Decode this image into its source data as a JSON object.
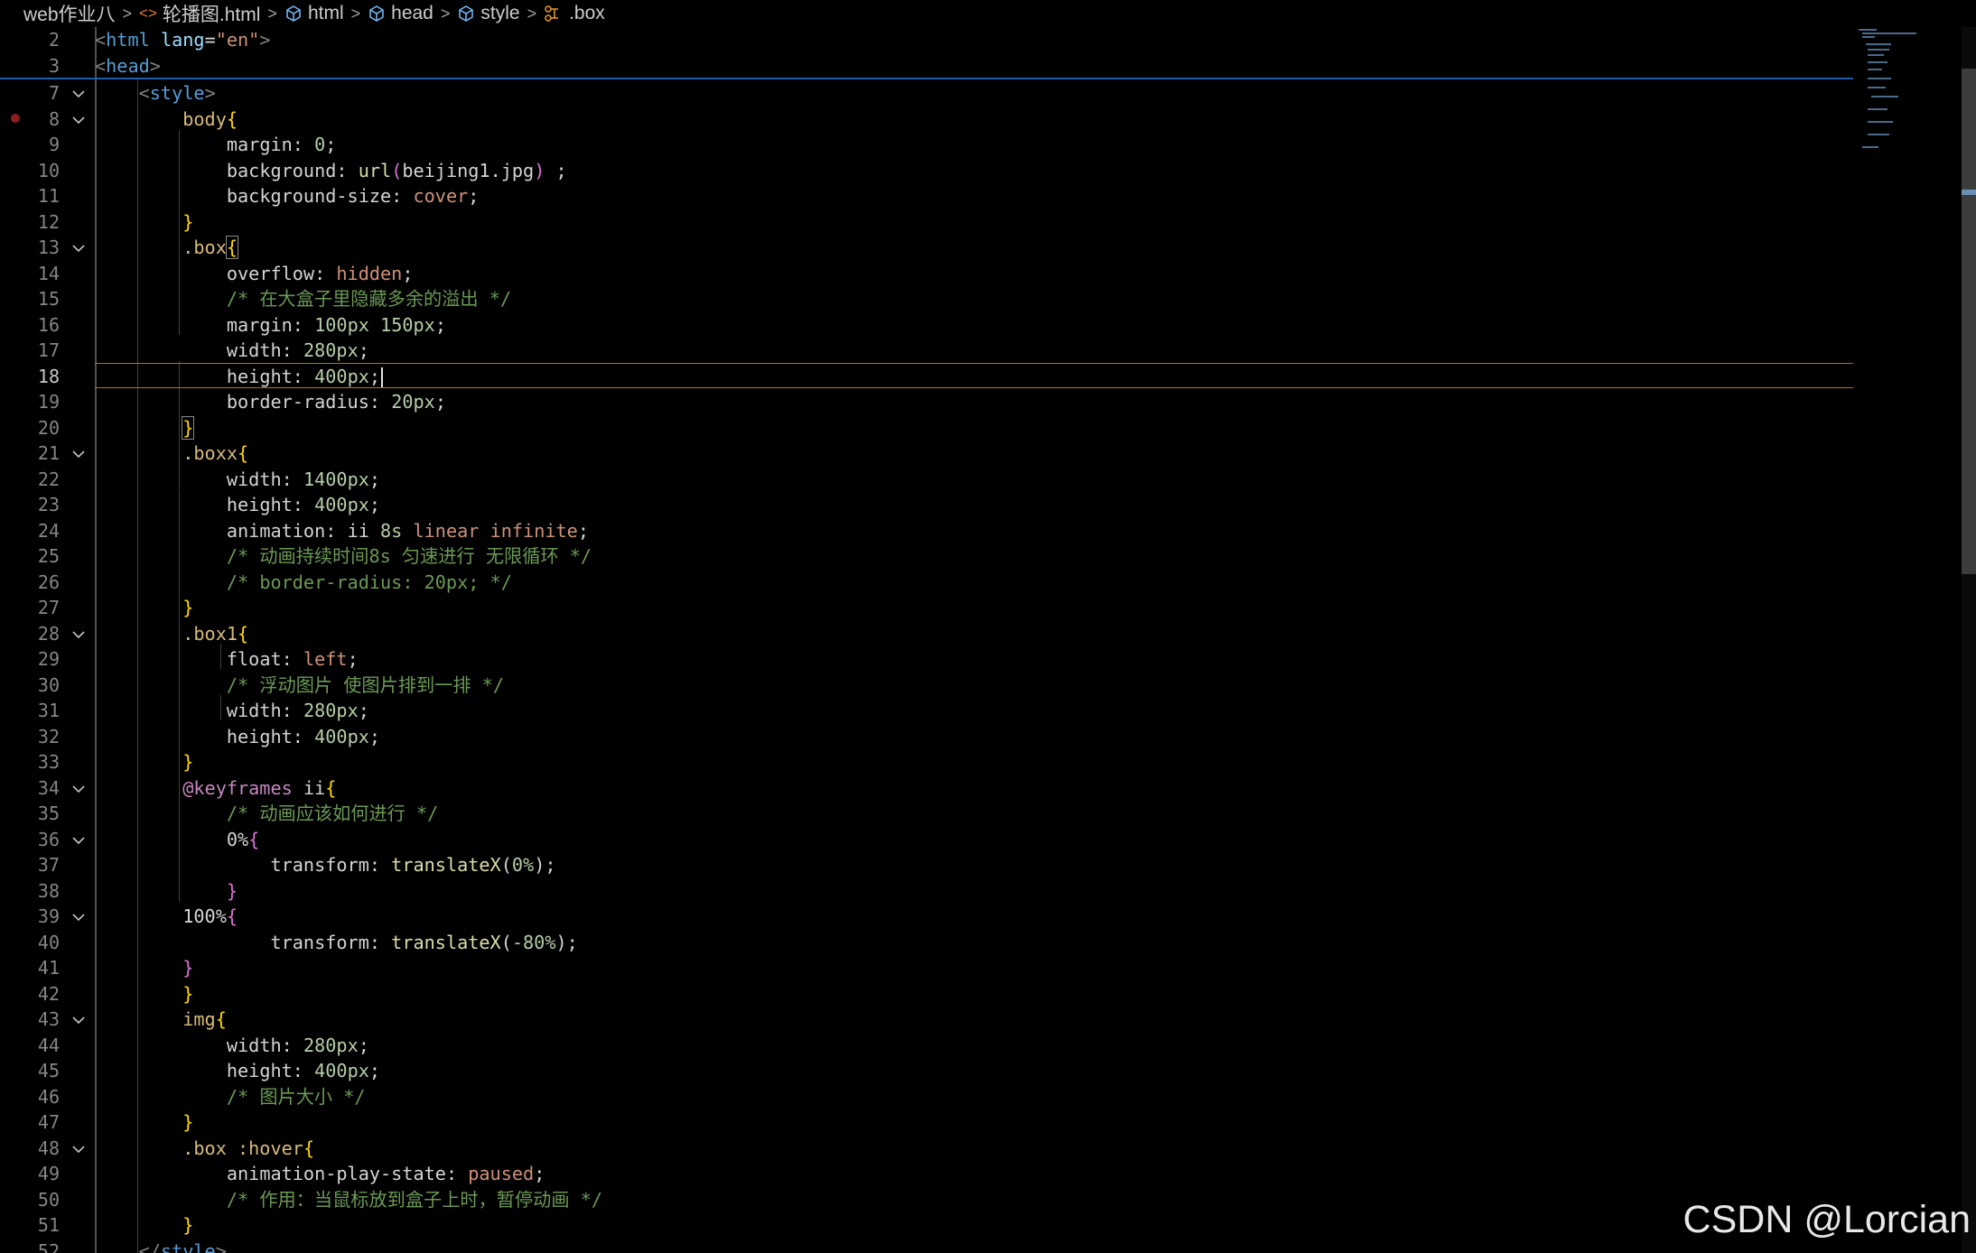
{
  "breadcrumb": {
    "folder": "web作业八",
    "file": "轮播图.html",
    "html": "html",
    "head": "head",
    "style": "style",
    "selector": ".box"
  },
  "watermark": "CSDN @Lorcian",
  "colors": {
    "background": "#000000",
    "current_line_border": "#c36a1e",
    "selector": "#d7ba7d",
    "comment": "#6a9955",
    "number": "#b5cea8",
    "string": "#ce9178",
    "tag": "#569cd6"
  },
  "icons": {
    "file": "html-file-icon",
    "element": "cube-icon",
    "selector": "css-selector-icon",
    "fold": "chevron-down-icon"
  },
  "lines": [
    {
      "n": "2",
      "text": "<html lang=\"en\">"
    },
    {
      "n": "3",
      "text": "<head>"
    },
    {
      "n": "7",
      "text": "<style>"
    },
    {
      "n": "8",
      "text": "body{"
    },
    {
      "n": "9",
      "text": "margin: 0;"
    },
    {
      "n": "10",
      "text": "background: url(beijing1.jpg) ;"
    },
    {
      "n": "11",
      "text": "background-size: cover;"
    },
    {
      "n": "12",
      "text": "}"
    },
    {
      "n": "13",
      "text": ".box{"
    },
    {
      "n": "14",
      "text": "overflow: hidden;"
    },
    {
      "n": "15",
      "text": "/* 在大盒子里隐藏多余的溢出 */"
    },
    {
      "n": "16",
      "text": "margin: 100px 150px;"
    },
    {
      "n": "17",
      "text": "width: 280px;"
    },
    {
      "n": "18",
      "text": "height: 400px;"
    },
    {
      "n": "19",
      "text": "border-radius: 20px;"
    },
    {
      "n": "20",
      "text": "}"
    },
    {
      "n": "21",
      "text": ".boxx{"
    },
    {
      "n": "22",
      "text": "width: 1400px;"
    },
    {
      "n": "23",
      "text": "height: 400px;"
    },
    {
      "n": "24",
      "text": "animation: ii 8s linear infinite;"
    },
    {
      "n": "25",
      "text": "/* 动画持续时间8s 匀速进行 无限循环 */"
    },
    {
      "n": "26",
      "text": "/* border-radius: 20px; */"
    },
    {
      "n": "27",
      "text": "}"
    },
    {
      "n": "28",
      "text": ".box1{"
    },
    {
      "n": "29",
      "text": "float: left;"
    },
    {
      "n": "30",
      "text": "/* 浮动图片 使图片排到一排 */"
    },
    {
      "n": "31",
      "text": "width: 280px;"
    },
    {
      "n": "32",
      "text": "height: 400px;"
    },
    {
      "n": "33",
      "text": "}"
    },
    {
      "n": "34",
      "text": "@keyframes ii{"
    },
    {
      "n": "35",
      "text": "/* 动画应该如何进行 */"
    },
    {
      "n": "36",
      "text": "0%{"
    },
    {
      "n": "37",
      "text": "transform: translateX(0%);"
    },
    {
      "n": "38",
      "text": "}"
    },
    {
      "n": "39",
      "text": "100%{"
    },
    {
      "n": "40",
      "text": "transform: translateX(-80%);"
    },
    {
      "n": "41",
      "text": "}"
    },
    {
      "n": "42",
      "text": "}"
    },
    {
      "n": "43",
      "text": "img{"
    },
    {
      "n": "44",
      "text": "width: 280px;"
    },
    {
      "n": "45",
      "text": "height: 400px;"
    },
    {
      "n": "46",
      "text": "/* 图片大小 */"
    },
    {
      "n": "47",
      "text": "}"
    },
    {
      "n": "48",
      "text": ".box :hover{"
    },
    {
      "n": "49",
      "text": "animation-play-state: paused;"
    },
    {
      "n": "50",
      "text": "/* 作用：当鼠标放到盒子上时，暂停动画 */"
    },
    {
      "n": "51",
      "text": "}"
    },
    {
      "n": "52",
      "text": "</style>"
    }
  ]
}
